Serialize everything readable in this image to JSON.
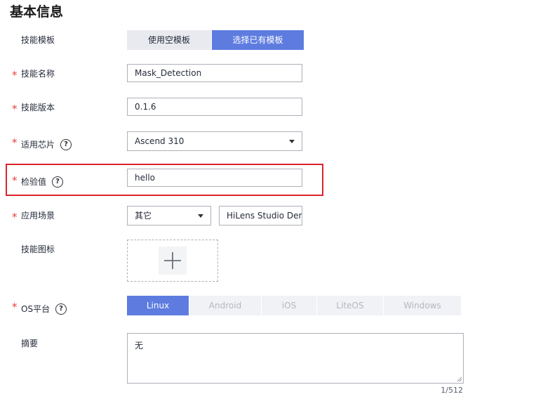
{
  "title": "基本信息",
  "template": {
    "label": "技能模板",
    "options": [
      "使用空模板",
      "选择已有模板"
    ],
    "selected": "选择已有模板"
  },
  "skill_name": {
    "label": "技能名称",
    "value": "Mask_Detection"
  },
  "skill_version": {
    "label": "技能版本",
    "value": "0.1.6"
  },
  "chip": {
    "label": "适用芯片",
    "value": "Ascend 310"
  },
  "checksum": {
    "label": "检验值",
    "value": "hello"
  },
  "scene": {
    "label": "应用场景",
    "category": "其它",
    "value": "HiLens Studio Demo"
  },
  "icon": {
    "label": "技能图标"
  },
  "os": {
    "label": "OS平台",
    "options": [
      "Linux",
      "Android",
      "iOS",
      "LiteOS",
      "Windows"
    ],
    "selected": "Linux"
  },
  "summary": {
    "label": "摘要",
    "value": "无",
    "counter": "1/512"
  },
  "required_mark": "*",
  "help_symbol": "?",
  "colors": {
    "accent": "#5e7ce0",
    "required": "#e5403f",
    "highlight_border": "#d9252c"
  },
  "icons": [
    "help-icon",
    "chevron-down-icon",
    "plus-icon",
    "resize-handle-icon"
  ]
}
